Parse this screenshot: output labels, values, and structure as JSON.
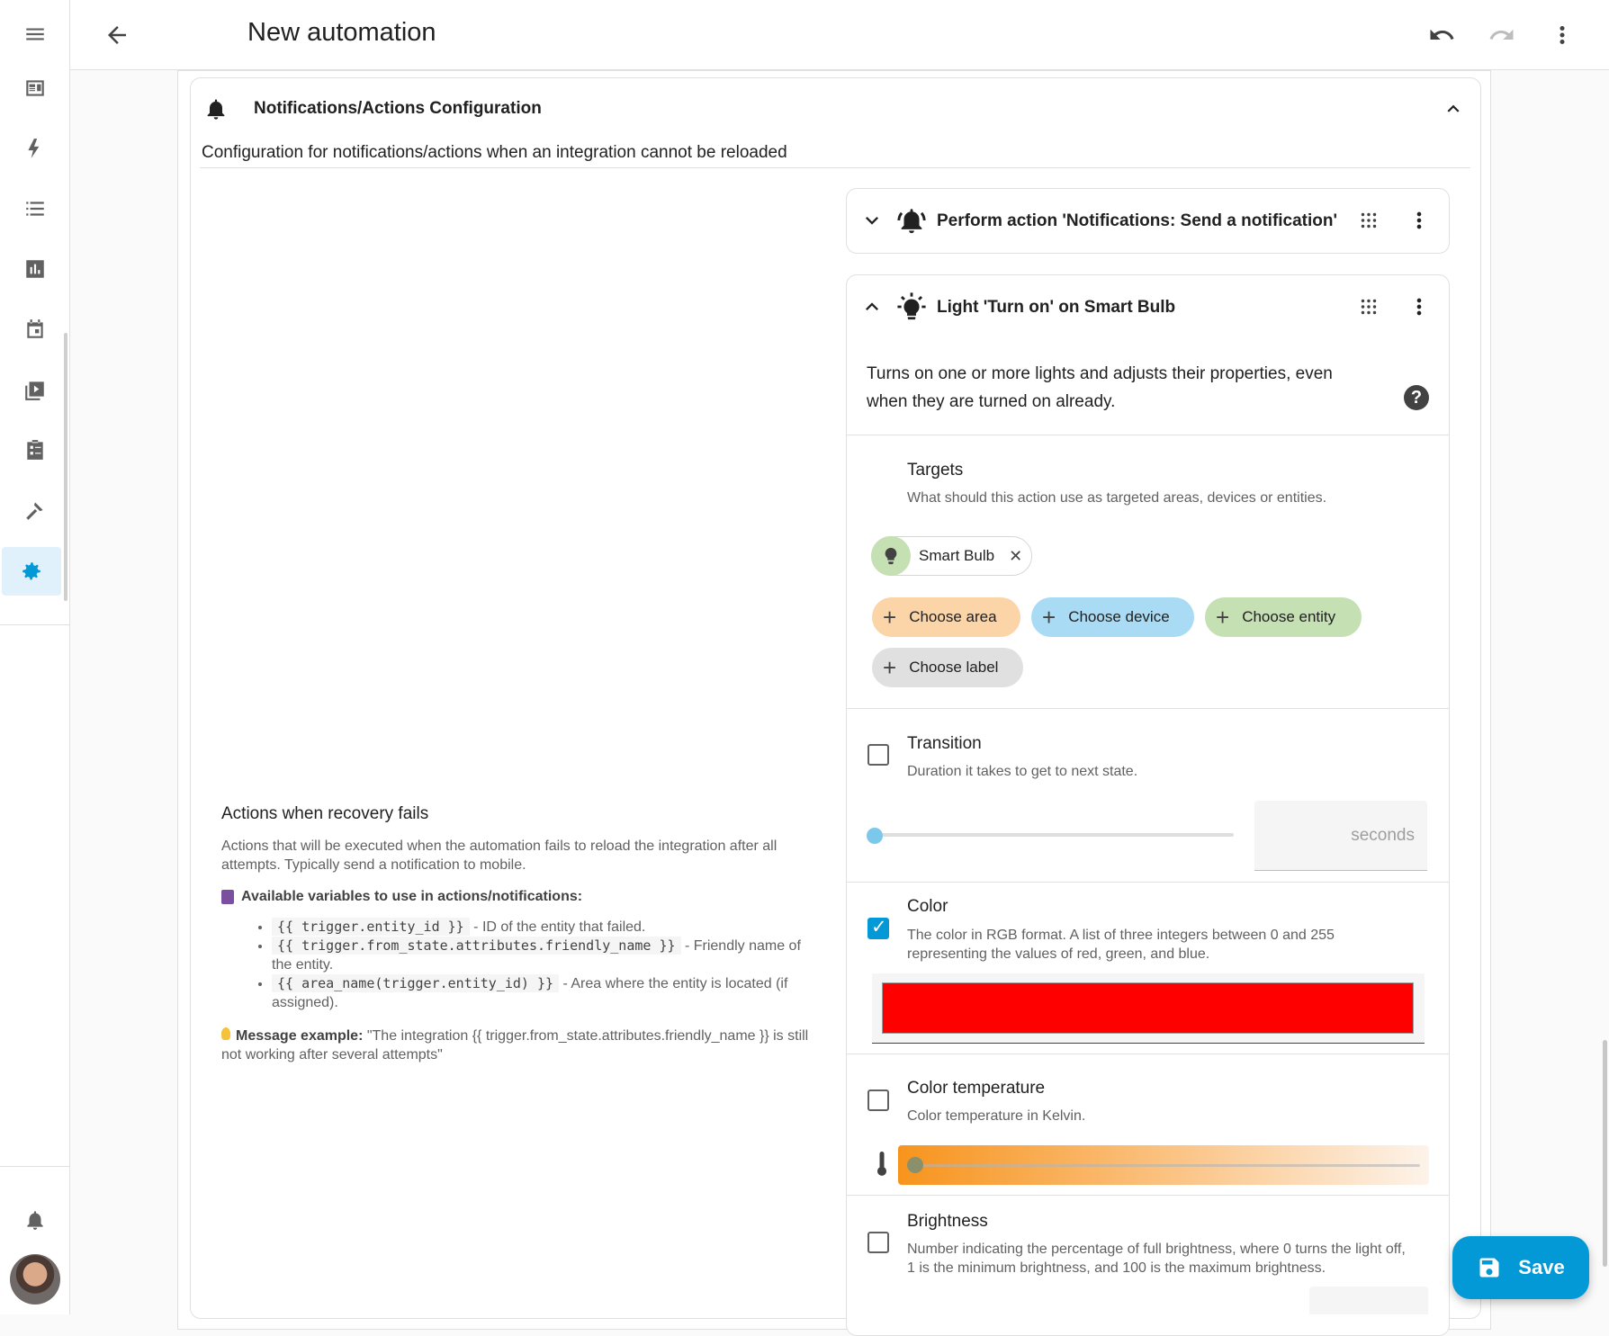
{
  "header": {
    "title": "New automation",
    "menu_icon": "menu-icon",
    "back_icon": "back-arrow-icon",
    "undo_icon": "undo-icon",
    "redo_icon": "redo-icon",
    "more_icon": "more-vert-icon"
  },
  "sidebar": {
    "items": [
      {
        "icon": "overview-icon"
      },
      {
        "icon": "energy-icon"
      },
      {
        "icon": "logbook-icon"
      },
      {
        "icon": "history-icon"
      },
      {
        "icon": "calendar-icon"
      },
      {
        "icon": "media-icon"
      },
      {
        "icon": "todo-icon"
      },
      {
        "icon": "developer-tools-icon"
      },
      {
        "icon": "settings-icon",
        "active": true
      }
    ],
    "notifications_icon": "bell-icon",
    "accent": "#0398d6"
  },
  "section": {
    "title": "Notifications/Actions Configuration",
    "description": "Configuration for notifications/actions when an integration cannot be reloaded"
  },
  "left": {
    "title": "Actions when recovery fails",
    "description": "Actions that will be executed when the automation fails to reload the integration after all attempts. Typically send a notification to mobile.",
    "vars_heading": "Available variables to use in actions/notifications:",
    "vars": [
      {
        "code": "{{ trigger.entity_id }}",
        "text": " - ID of the entity that failed."
      },
      {
        "code": "{{ trigger.from_state.attributes.friendly_name }}",
        "text": " - Friendly name of the entity."
      },
      {
        "code": "{{ area_name(trigger.entity_id) }}",
        "text": " - Area where the entity is located (if assigned)."
      }
    ],
    "msg_label": "Message example:",
    "msg_text": " \"The integration {{ trigger.from_state.attributes.friendly_name }} is still not working after several attempts\""
  },
  "actions": {
    "notify_title": "Perform action 'Notifications: Send a notification'",
    "light_title": "Light 'Turn on' on Smart Bulb",
    "light_desc": "Turns on one or more lights and adjusts their properties, even when they are turned on already."
  },
  "targets": {
    "title": "Targets",
    "desc": "What should this action use as targeted areas, devices or entities.",
    "selected_chip": "Smart Bulb",
    "choose_area": "Choose area",
    "choose_device": "Choose device",
    "choose_entity": "Choose entity",
    "choose_label": "Choose label"
  },
  "transition": {
    "title": "Transition",
    "desc": "Duration it takes to get to next state.",
    "unit": "seconds",
    "checked": false,
    "value_fraction": 0
  },
  "color": {
    "title": "Color",
    "desc": "The color in RGB format. A list of three integers between 0 and 255 representing the values of red, green, and blue.",
    "checked": true,
    "value": "#ff0000"
  },
  "color_temp": {
    "title": "Color temperature",
    "desc": "Color temperature in Kelvin.",
    "checked": false
  },
  "brightness": {
    "title": "Brightness",
    "desc": "Number indicating the percentage of full brightness, where 0 turns the light off, 1 is the minimum brightness, and 100 is the maximum brightness.",
    "checked": false
  },
  "save_label": "Save"
}
